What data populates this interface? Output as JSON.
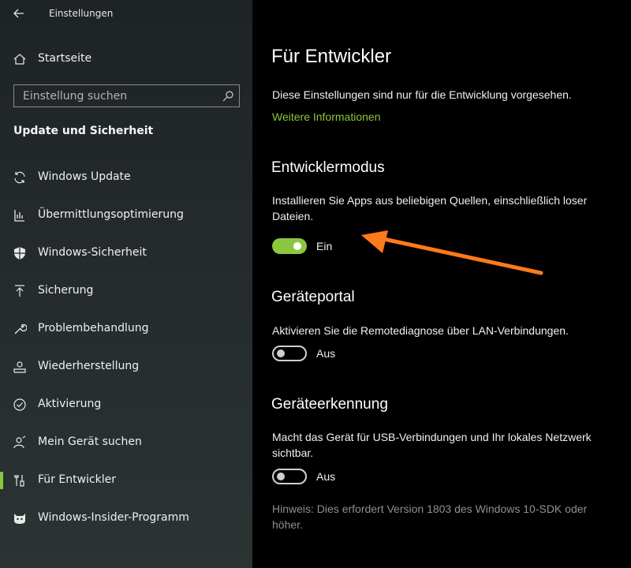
{
  "window": {
    "title": "Einstellungen"
  },
  "sidebar": {
    "home_label": "Startseite",
    "search_placeholder": "Einstellung suchen",
    "section_title": "Update und Sicherheit",
    "items": [
      {
        "label": "Windows Update",
        "icon": "refresh-icon"
      },
      {
        "label": "Übermittlungsoptimierung",
        "icon": "delivery-icon"
      },
      {
        "label": "Windows-Sicherheit",
        "icon": "shield-icon"
      },
      {
        "label": "Sicherung",
        "icon": "upload-icon"
      },
      {
        "label": "Problembehandlung",
        "icon": "wrench-icon"
      },
      {
        "label": "Wiederherstellung",
        "icon": "recovery-icon"
      },
      {
        "label": "Aktivierung",
        "icon": "check-circle-icon"
      },
      {
        "label": "Mein Gerät suchen",
        "icon": "person-locate-icon"
      },
      {
        "label": "Für Entwickler",
        "icon": "developer-tools-icon",
        "selected": true
      },
      {
        "label": "Windows-Insider-Programm",
        "icon": "insider-cat-icon"
      }
    ]
  },
  "main": {
    "title": "Für Entwickler",
    "intro": "Diese Einstellungen sind nur für die Entwicklung vorgesehen.",
    "more_info": "Weitere Informationen",
    "dev_mode": {
      "heading": "Entwicklermodus",
      "desc_line1": "Installieren Sie Apps aus beliebigen Quellen, einschließlich loser",
      "desc_line2": "Dateien.",
      "toggle_state": "Ein"
    },
    "device_portal": {
      "heading": "Geräteportal",
      "desc": "Aktivieren Sie die Remotediagnose über LAN-Verbindungen.",
      "toggle_state": "Aus"
    },
    "device_discovery": {
      "heading": "Geräteerkennung",
      "desc_line1": "Macht das Gerät für USB-Verbindungen und Ihr lokales Netzwerk",
      "desc_line2": "sichtbar.",
      "toggle_state": "Aus",
      "hint_line1": "Hinweis: Dies erfordert Version 1803 des Windows 10-SDK oder",
      "hint_line2": "höher."
    }
  },
  "colors": {
    "accent": "#8cc63f",
    "annotation_arrow": "#ff7a1a",
    "sidebar_bg": "#252b2d",
    "main_bg": "#000000"
  }
}
